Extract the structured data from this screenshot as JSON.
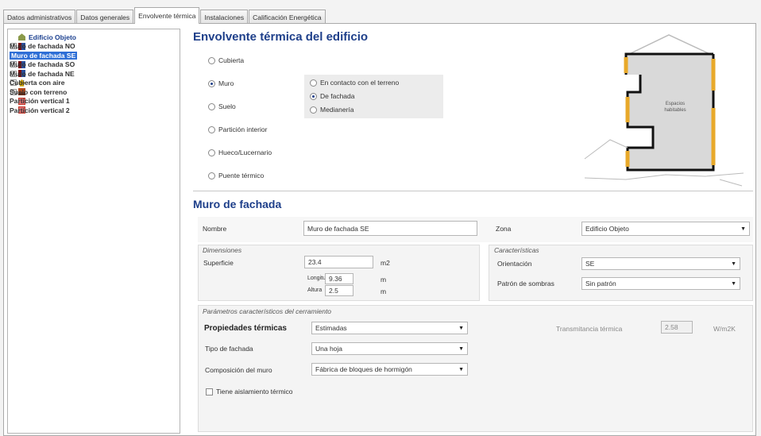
{
  "tabs": [
    {
      "label": "Datos administrativos",
      "active": false
    },
    {
      "label": "Datos generales",
      "active": false
    },
    {
      "label": "Envolvente térmica",
      "active": true
    },
    {
      "label": "Instalaciones",
      "active": false
    },
    {
      "label": "Calificación Energética",
      "active": false
    }
  ],
  "tree": {
    "root": "Edificio Objeto",
    "items": [
      {
        "label": "Muro de fachada NO",
        "icon": "wall-icon"
      },
      {
        "label": "Muro de fachada SE",
        "icon": "wall-icon",
        "selected": true
      },
      {
        "label": "Muro de fachada SO",
        "icon": "wall-icon"
      },
      {
        "label": "Muro de fachada NE",
        "icon": "wall-icon"
      },
      {
        "label": "Cubierta con aire",
        "icon": "roof-icon"
      },
      {
        "label": "Suelo con terreno",
        "icon": "floor-icon"
      },
      {
        "label": "Partición vertical 1",
        "icon": "partition-icon"
      },
      {
        "label": "Partición vertical 2",
        "icon": "partition-icon"
      }
    ]
  },
  "envelope": {
    "title": "Envolvente térmica del edificio",
    "types": [
      {
        "label": "Cubierta",
        "checked": false
      },
      {
        "label": "Muro",
        "checked": true
      },
      {
        "label": "Suelo",
        "checked": false
      },
      {
        "label": "Partición interior",
        "checked": false
      },
      {
        "label": "Hueco/Lucernario",
        "checked": false
      },
      {
        "label": "Puente térmico",
        "checked": false
      }
    ],
    "subtypes": [
      {
        "label": "En contacto con el terreno",
        "checked": false
      },
      {
        "label": "De fachada",
        "checked": true
      },
      {
        "label": "Medianería",
        "checked": false
      }
    ],
    "diagram_label_1": "Espacios",
    "diagram_label_2": "habitables"
  },
  "wall": {
    "section_title": "Muro de fachada",
    "name_label": "Nombre",
    "name_value": "Muro de fachada SE",
    "zone_label": "Zona",
    "zone_value": "Edificio Objeto",
    "dimensions_label": "Dimensiones",
    "surface_label": "Superficie",
    "surface_value": "23.4",
    "surface_unit": "m2",
    "length_label": "Longitud",
    "length_value": "9.36",
    "length_unit": "m",
    "height_label": "Altura",
    "height_value": "2.5",
    "height_unit": "m",
    "characteristics_label": "Características",
    "orientation_label": "Orientación",
    "orientation_value": "SE",
    "shadow_label": "Patrón de sombras",
    "shadow_value": "Sin patrón"
  },
  "params": {
    "title": "Parámetros característicos del cerramiento",
    "thermal_label": "Propiedades térmicas",
    "thermal_value": "Estimadas",
    "facade_type_label": "Tipo de fachada",
    "facade_type_value": "Una hoja",
    "composition_label": "Composición del muro",
    "composition_value": "Fábrica de bloques de hormigón",
    "transmittance_label": "Transmitancia térmica",
    "transmittance_value": "2.58",
    "transmittance_unit": "W/m2K",
    "insulation_label": "Tiene aislamiento térmico",
    "insulation_checked": false
  },
  "colors": {
    "accent": "#1e3f8a",
    "selection": "#2f6fd6",
    "wall_highlight": "#e8a92a"
  }
}
